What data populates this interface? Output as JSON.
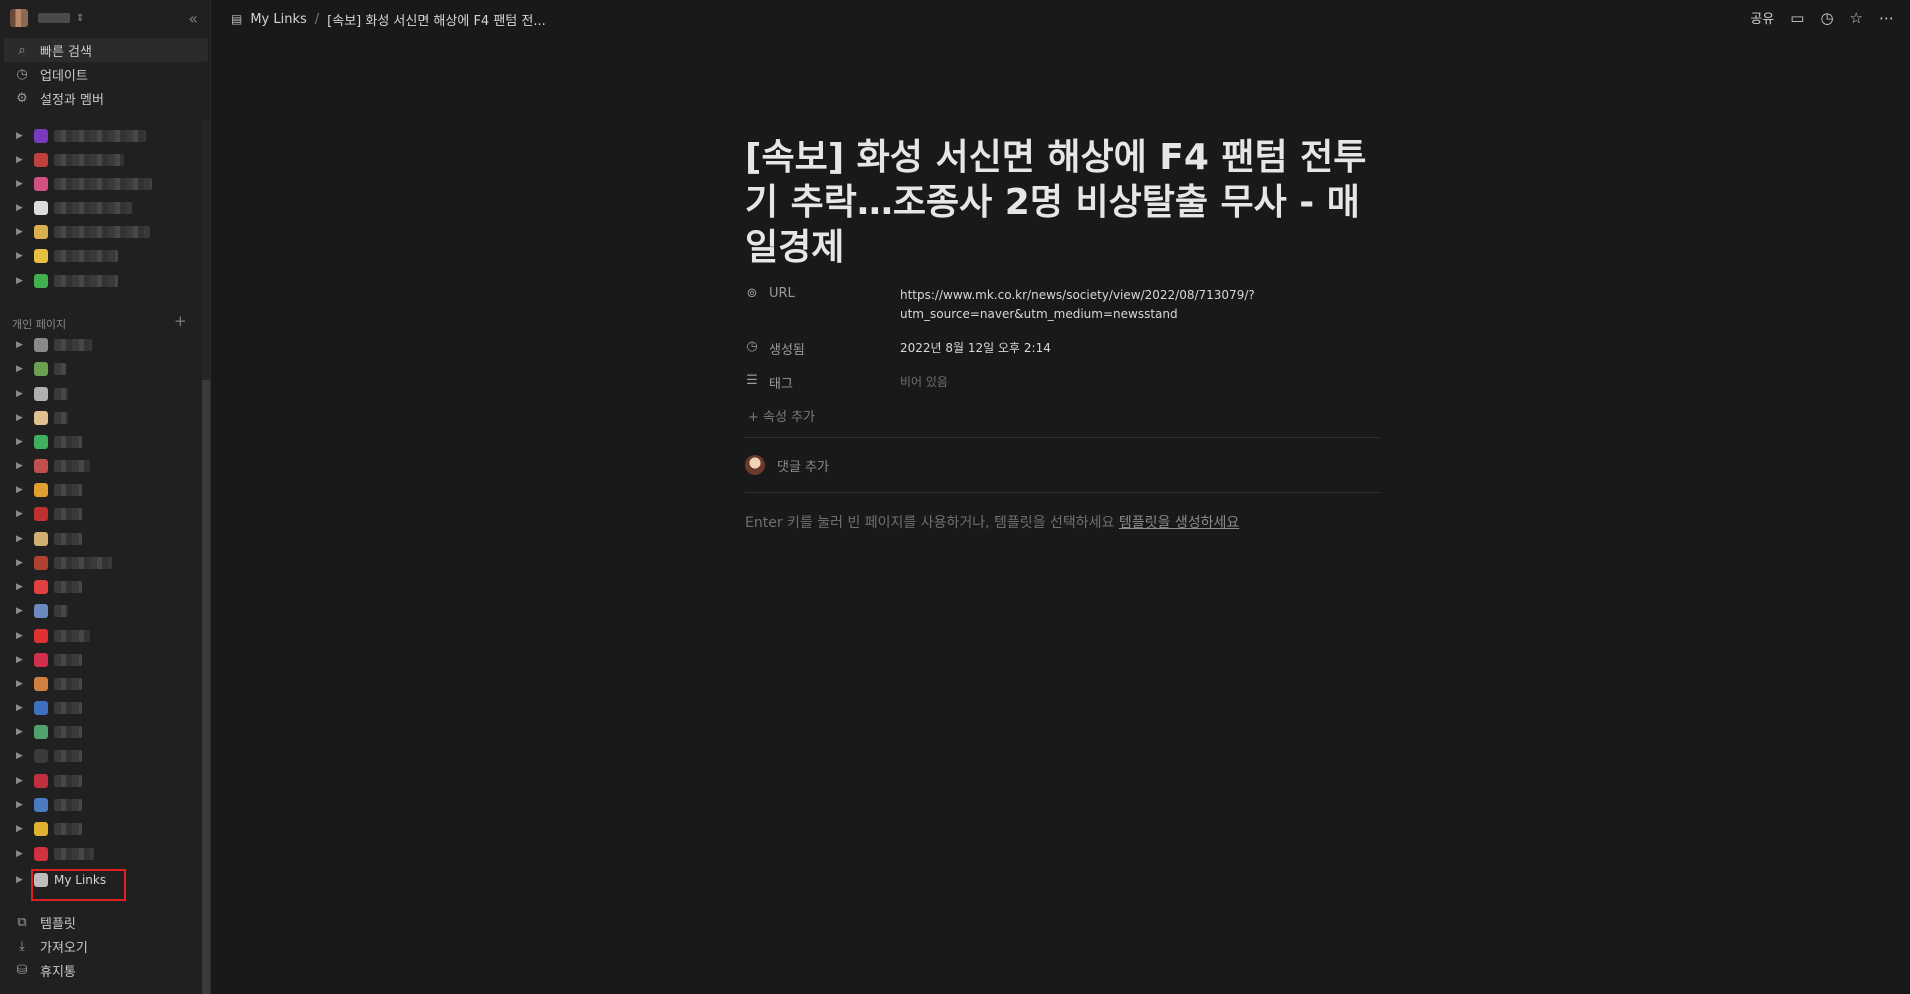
{
  "sidebar": {
    "nav": [
      {
        "icon": "search-icon",
        "glyph": "⌕",
        "label": "빠른 검색"
      },
      {
        "icon": "clock-icon",
        "glyph": "◷",
        "label": "업데이트"
      },
      {
        "icon": "gear-icon",
        "glyph": "⚙",
        "label": "설정과 멤버"
      }
    ],
    "section_label": "개인 페이지",
    "bottom": [
      {
        "icon": "template-icon",
        "glyph": "⧉",
        "label": "템플릿"
      },
      {
        "icon": "import-icon",
        "glyph": "⤓",
        "label": "가져오기"
      },
      {
        "icon": "trash-icon",
        "glyph": "🗑",
        "label": "휴지통"
      }
    ],
    "my_links_label": "My Links"
  },
  "topbar": {
    "breadcrumb_root": "My Links",
    "breadcrumb_page": "[속보] 화성 서신면 해상에 F4 팬텀 전...",
    "share_label": "공유"
  },
  "page": {
    "title": "[속보] 화성 서신면 해상에 F4 팬텀 전투기 추락…조종사 2명 비상탈출 무사 - 매일경제",
    "props": {
      "url_name": "URL",
      "url_value": "https://www.mk.co.kr/news/society/view/2022/08/713079/?utm_source=naver&utm_medium=newsstand",
      "created_name": "생성됨",
      "created_value": "2022년 8월 12일 오후 2:14",
      "tags_name": "태그",
      "tags_value": "비어 있음"
    },
    "add_property": "+ 속성 추가",
    "add_comment": "댓글 추가",
    "hint_text": "Enter 키를 눌러 빈 페이지를 사용하거나, 템플릿을 선택하세요 ",
    "hint_link": "템플릿을 생성하세요"
  },
  "colors": {
    "background": "#191919",
    "sidebar": "#202020",
    "highlight_box": "#e02020"
  }
}
